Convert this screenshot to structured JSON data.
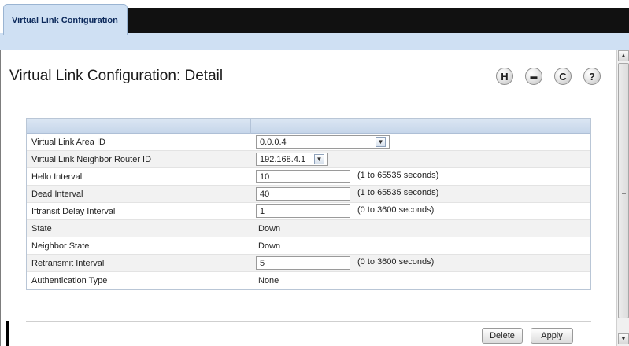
{
  "tab": {
    "label": "Virtual Link Configuration"
  },
  "page": {
    "title": "Virtual Link Configuration: Detail"
  },
  "toolbar": {
    "icons": [
      {
        "name": "save-icon",
        "glyph": "H"
      },
      {
        "name": "print-icon",
        "glyph": "▬"
      },
      {
        "name": "refresh-icon",
        "glyph": "C"
      },
      {
        "name": "help-icon",
        "glyph": "?"
      }
    ]
  },
  "form": {
    "area_id": {
      "label": "Virtual Link Area ID",
      "value": "0.0.0.4"
    },
    "neighbor_router_id": {
      "label": "Virtual Link Neighbor Router ID",
      "value": "192.168.4.1"
    },
    "hello_interval": {
      "label": "Hello Interval",
      "value": "10",
      "hint": "(1 to 65535 seconds)"
    },
    "dead_interval": {
      "label": "Dead Interval",
      "value": "40",
      "hint": "(1 to 65535 seconds)"
    },
    "transit_delay": {
      "label": "Iftransit Delay Interval",
      "value": "1",
      "hint": "(0 to 3600 seconds)"
    },
    "state": {
      "label": "State",
      "value": "Down"
    },
    "neighbor_state": {
      "label": "Neighbor State",
      "value": "Down"
    },
    "retransmit_interval": {
      "label": "Retransmit Interval",
      "value": "5",
      "hint": "(0 to 3600 seconds)"
    },
    "auth_type": {
      "label": "Authentication Type",
      "value": "None"
    }
  },
  "actions": {
    "delete_label": "Delete",
    "apply_label": "Apply"
  },
  "colors": {
    "header_bg": "#cfe0f3",
    "tab_strip": "#111111",
    "title_text": "#0d2a5c"
  }
}
